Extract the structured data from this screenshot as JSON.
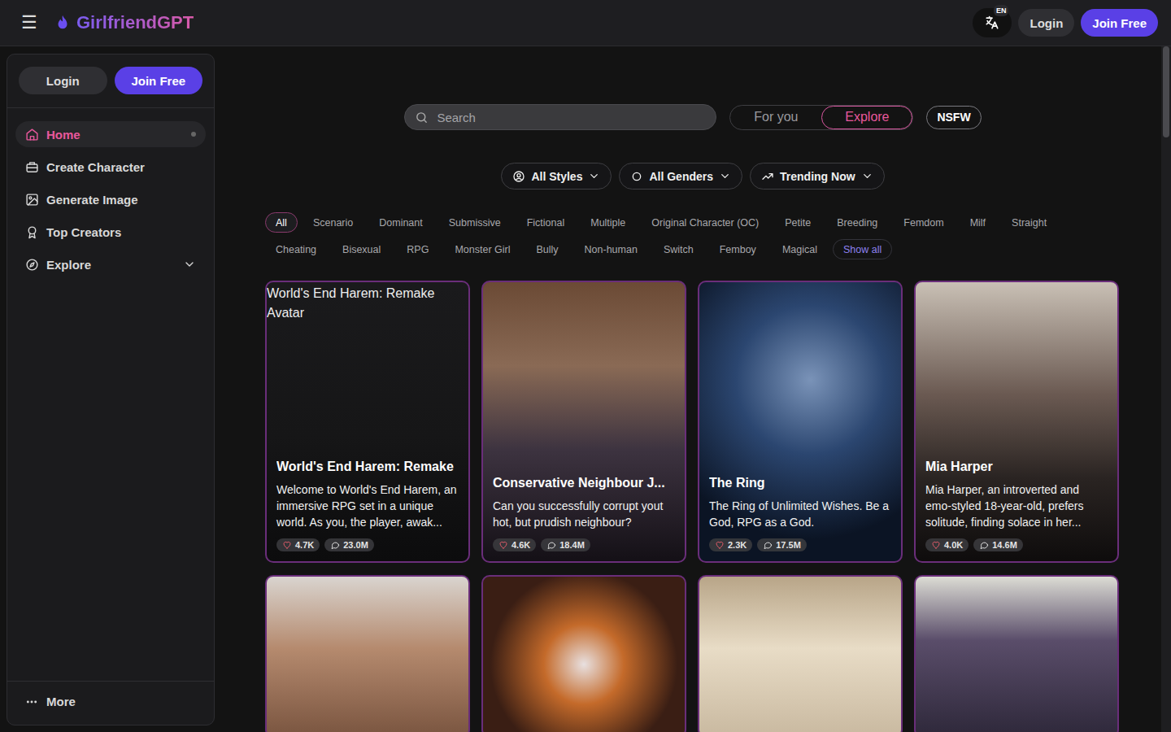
{
  "header": {
    "menu": "☰",
    "logo": "GirlfriendGPT",
    "language": "EN",
    "login": "Login",
    "join": "Join Free"
  },
  "sidebar": {
    "login": "Login",
    "join": "Join Free",
    "items": [
      {
        "label": "Home",
        "selected": true
      },
      {
        "label": "Create Character",
        "selected": false
      },
      {
        "label": "Generate Image",
        "selected": false
      },
      {
        "label": "Top Creators",
        "selected": false
      },
      {
        "label": "Explore",
        "selected": false,
        "expanded": false
      }
    ],
    "more": "More"
  },
  "search": {
    "placeholder": "Search"
  },
  "feed_tabs": [
    {
      "label": "For you",
      "selected": false
    },
    {
      "label": "Explore",
      "selected": true
    }
  ],
  "nsfw": "NSFW",
  "filters": [
    "All Styles",
    "All Genders",
    "Trending Now"
  ],
  "tags": [
    {
      "label": "All",
      "selected": true
    },
    {
      "label": "Scenario",
      "selected": false
    },
    {
      "label": "Dominant",
      "selected": false
    },
    {
      "label": "Submissive",
      "selected": false
    },
    {
      "label": "Fictional",
      "selected": false
    },
    {
      "label": "Multiple",
      "selected": false
    },
    {
      "label": "Original Character (OC)",
      "selected": false
    },
    {
      "label": "Petite",
      "selected": false
    },
    {
      "label": "Breeding",
      "selected": false
    },
    {
      "label": "Femdom",
      "selected": false
    },
    {
      "label": "Milf",
      "selected": false
    },
    {
      "label": "Straight",
      "selected": false
    },
    {
      "label": "Cheating",
      "selected": false
    },
    {
      "label": "Bisexual",
      "selected": false
    },
    {
      "label": "RPG",
      "selected": false
    },
    {
      "label": "Monster Girl",
      "selected": false
    },
    {
      "label": "Bully",
      "selected": false
    },
    {
      "label": "Non-human",
      "selected": false
    },
    {
      "label": "Switch",
      "selected": false
    },
    {
      "label": "Femboy",
      "selected": false
    },
    {
      "label": "Magical",
      "selected": false
    }
  ],
  "show_all": "Show all",
  "cards": [
    {
      "image_alt": "World's End Harem: Remake Avatar",
      "title": "World's End Harem: Remake",
      "description": "Welcome to World's End Harem, an immersive RPG set in a unique world. As you, the player, awak...",
      "likes": "4.7K",
      "chats": "23.0M"
    },
    {
      "image_alt": "",
      "title": "Conservative Neighbour J...",
      "description": "Can you successfully corrupt yout hot, but prudish neighbour?",
      "likes": "4.6K",
      "chats": "18.4M"
    },
    {
      "image_alt": "",
      "title": "The Ring",
      "description": "The Ring of Unlimited Wishes. Be a God, RPG as a God.",
      "likes": "2.3K",
      "chats": "17.5M"
    },
    {
      "image_alt": "",
      "title": "Mia Harper",
      "description": "Mia Harper, an introverted and emo-styled 18-year-old, prefers solitude, finding solace in her...",
      "likes": "4.0K",
      "chats": "14.6M"
    }
  ],
  "more_cards": [
    {},
    {},
    {},
    {}
  ]
}
